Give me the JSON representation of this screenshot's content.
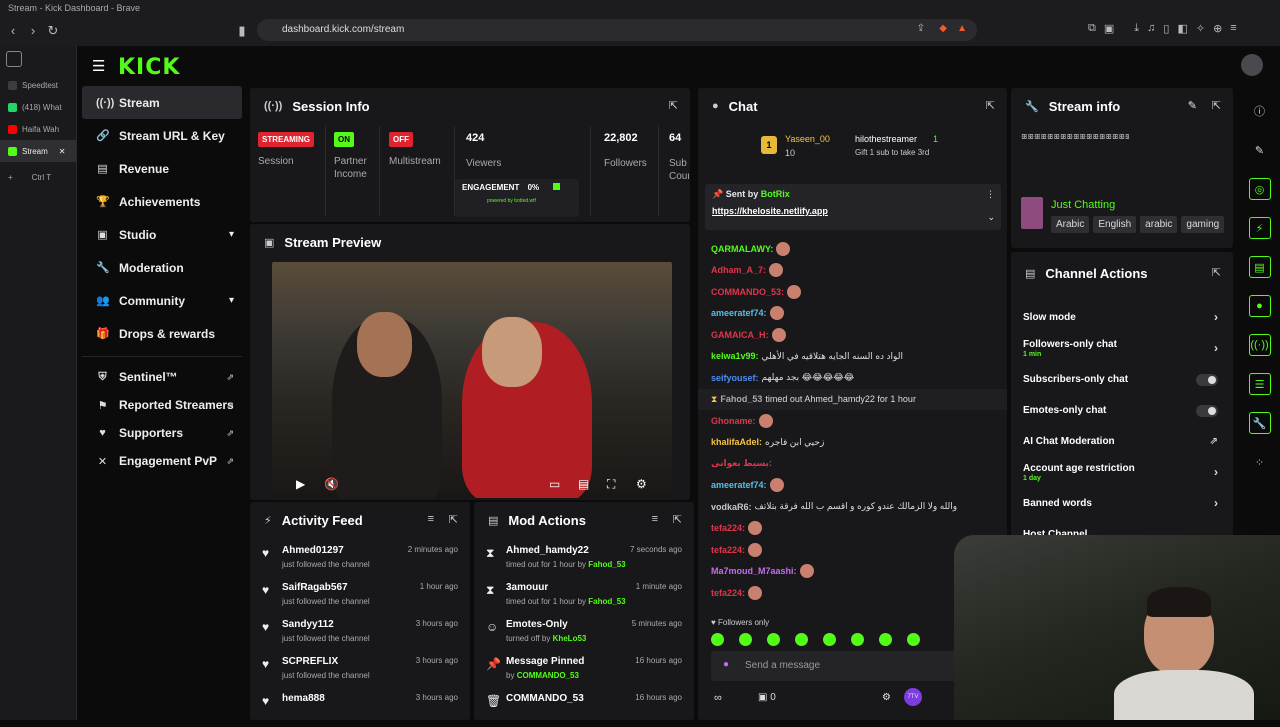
{
  "browser": {
    "window_title": "Stream - Kick Dashboard - Brave",
    "url": "dashboard.kick.com/stream",
    "tabs": [
      {
        "label": "Speedtest",
        "color": "#3c3c44"
      },
      {
        "label": "(418) What",
        "color": "#25d366"
      },
      {
        "label": "Haifa Wah",
        "color": "#ff0000"
      },
      {
        "label": "Stream",
        "color": "#53fc18"
      }
    ],
    "new_tab_shortcut": "Ctrl T"
  },
  "app": {
    "logo": "KICK"
  },
  "sidebar": {
    "items": [
      {
        "label": "Stream",
        "icon": "radio-icon"
      },
      {
        "label": "Stream URL & Key",
        "icon": "link-icon"
      },
      {
        "label": "Revenue",
        "icon": "wallet-icon"
      },
      {
        "label": "Achievements",
        "icon": "trophy-icon"
      },
      {
        "label": "Studio",
        "icon": "monitor-icon"
      },
      {
        "label": "Moderation",
        "icon": "wrench-icon"
      },
      {
        "label": "Community",
        "icon": "people-icon"
      },
      {
        "label": "Drops & rewards",
        "icon": "gift-icon"
      }
    ],
    "external": [
      {
        "label": "Sentinel™"
      },
      {
        "label": "Reported Streamers"
      },
      {
        "label": "Supporters"
      },
      {
        "label": "Engagement PvP"
      }
    ]
  },
  "session": {
    "title": "Session Info",
    "streaming_badge": "STREAMING",
    "session_label": "Session",
    "partner_badge": "ON",
    "partner_label": "Partner Income",
    "multistream_badge": "OFF",
    "multistream_label": "Multistream",
    "viewers": "424",
    "viewers_label": "Viewers",
    "engagement_label": "ENGAGEMENT",
    "engagement_value": "0%",
    "powered": "powered by botted.wtf",
    "followers": "22,802",
    "followers_label": "Followers",
    "subs": "64",
    "subs_label": "Sub Count"
  },
  "preview": {
    "title": "Stream Preview"
  },
  "activity": {
    "title": "Activity Feed",
    "items": [
      {
        "name": "Ahmed01297",
        "sub": "just followed the channel",
        "time": "2 minutes ago"
      },
      {
        "name": "SaifRagab567",
        "sub": "just followed the channel",
        "time": "1 hour ago"
      },
      {
        "name": "Sandyy112",
        "sub": "just followed the channel",
        "time": "3 hours ago"
      },
      {
        "name": "SCPREFLIX",
        "sub": "just followed the channel",
        "time": "3 hours ago"
      },
      {
        "name": "hema888",
        "sub": "",
        "time": "3 hours ago"
      }
    ]
  },
  "modactions": {
    "title": "Mod Actions",
    "items": [
      {
        "icon": "hourglass-icon",
        "name": "Ahmed_hamdy22",
        "sub": "timed out for 1 hour by",
        "by": "Fahod_53",
        "time": "7 seconds ago"
      },
      {
        "icon": "hourglass-icon",
        "name": "3amouur",
        "sub": "timed out for 1 hour by",
        "by": "Fahod_53",
        "time": "1 minute ago"
      },
      {
        "icon": "smile-icon",
        "name": "Emotes-Only",
        "sub": "turned off by",
        "by": "KheLo53",
        "time": "5 minutes ago"
      },
      {
        "icon": "pin-icon",
        "name": "Message Pinned",
        "sub": "by",
        "by": "COMMANDO_53",
        "time": "16 hours ago"
      },
      {
        "icon": "trash-icon",
        "name": "COMMANDO_53",
        "sub": "",
        "by": "",
        "time": "16 hours ago"
      }
    ]
  },
  "chat": {
    "title": "Chat",
    "top_gifter": "Yaseen_00",
    "top_gifter_count": "10",
    "gift_user": "hilothestreamer",
    "gift_count": "1",
    "gift_text": "Gift 1 sub to take 3rd",
    "pinned_sent_by": "Sent by",
    "pinned_user": "BotRix",
    "pinned_link": "https://khelosite.netlify.app",
    "messages": [
      {
        "user": "QARMALAWY:",
        "color": "#53fc18",
        "text": "",
        "emote": true
      },
      {
        "user": "Adham_A_7:",
        "color": "#e0354a",
        "text": "",
        "emote": true
      },
      {
        "user": "COMMANDO_53:",
        "color": "#e0354a",
        "text": "",
        "emote": true
      },
      {
        "user": "ameeratef74:",
        "color": "#53c0e8",
        "text": "",
        "emote": true
      },
      {
        "user": "GAMAICA_H:",
        "color": "#e0354a",
        "text": "",
        "emote": true
      },
      {
        "user": "kelwa1v99:",
        "color": "#53fc18",
        "text": "الواد ده السنه الجايه هتلاقيه في الأهلي",
        "emote": false
      },
      {
        "user": "seifyousef:",
        "color": "#4c8cf5",
        "text": "بجد مهلهم 😂😂😂😂😂",
        "emote": false
      },
      {
        "user": "Fahod_53",
        "color": "#aaaaaa",
        "text": "timed out Ahmed_hamdy22 for 1 hour",
        "emote": false
      },
      {
        "user": "Ghoname:",
        "color": "#e0354a",
        "text": "",
        "emote": true
      },
      {
        "user": "khalifaAdel:",
        "color": "#f5c542",
        "text": "زحيي ابن فاجره",
        "emote": false
      },
      {
        "user": "بسيط بعوانى:",
        "color": "#e0354a",
        "text": "",
        "emote": false
      },
      {
        "user": "ameeratef74:",
        "color": "#53c0e8",
        "text": "",
        "emote": true
      },
      {
        "user": "vodkaR6:",
        "color": "#c8c8c8",
        "text": "والله ولا الزمالك عندو كوره و اقسم ب الله فرقة بتلاتف",
        "emote": false
      },
      {
        "user": "tefa224:",
        "color": "#e0354a",
        "text": "",
        "emote": true
      },
      {
        "user": "tefa224:",
        "color": "#e0354a",
        "text": "",
        "emote": true
      },
      {
        "user": "Ma7moud_M7aashi:",
        "color": "#c56cf0",
        "text": "",
        "emote": true
      },
      {
        "user": "tefa224:",
        "color": "#e0354a",
        "text": "",
        "emote": true
      }
    ],
    "followers_only": "Followers only",
    "placeholder": "Send a message",
    "viewers_icon_count": "0"
  },
  "streaminfo": {
    "title": "Stream info",
    "stream_title": "ꕥꕥꕥꕥꕥꕥꕥꕥꕥꕥꕥꕥꕥꕥꕥꕥꕥꕥꕥꕥꕥꕥꕥꕥꕥꕥ",
    "category": "Just Chatting",
    "tags": [
      "Arabic",
      "English",
      "arabic",
      "gaming"
    ]
  },
  "channelactions": {
    "title": "Channel Actions",
    "rows": [
      {
        "label": "Slow mode",
        "sub": "",
        "type": "arrow"
      },
      {
        "label": "Followers-only chat",
        "sub": "1 min",
        "type": "arrow"
      },
      {
        "label": "Subscribers-only chat",
        "sub": "",
        "type": "toggle"
      },
      {
        "label": "Emotes-only chat",
        "sub": "",
        "type": "toggle"
      },
      {
        "label": "AI Chat Moderation",
        "sub": "",
        "type": "ext"
      },
      {
        "label": "Account age restriction",
        "sub": "1 day",
        "type": "arrow"
      },
      {
        "label": "Banned words",
        "sub": "",
        "type": "arrow"
      },
      {
        "label": "Host Channel",
        "sub": "",
        "type": "none"
      }
    ]
  },
  "colors": {
    "accent": "#53fc18",
    "panel": "#18181b",
    "bg": "#0b0b0c",
    "streaming": "#e0242f"
  }
}
